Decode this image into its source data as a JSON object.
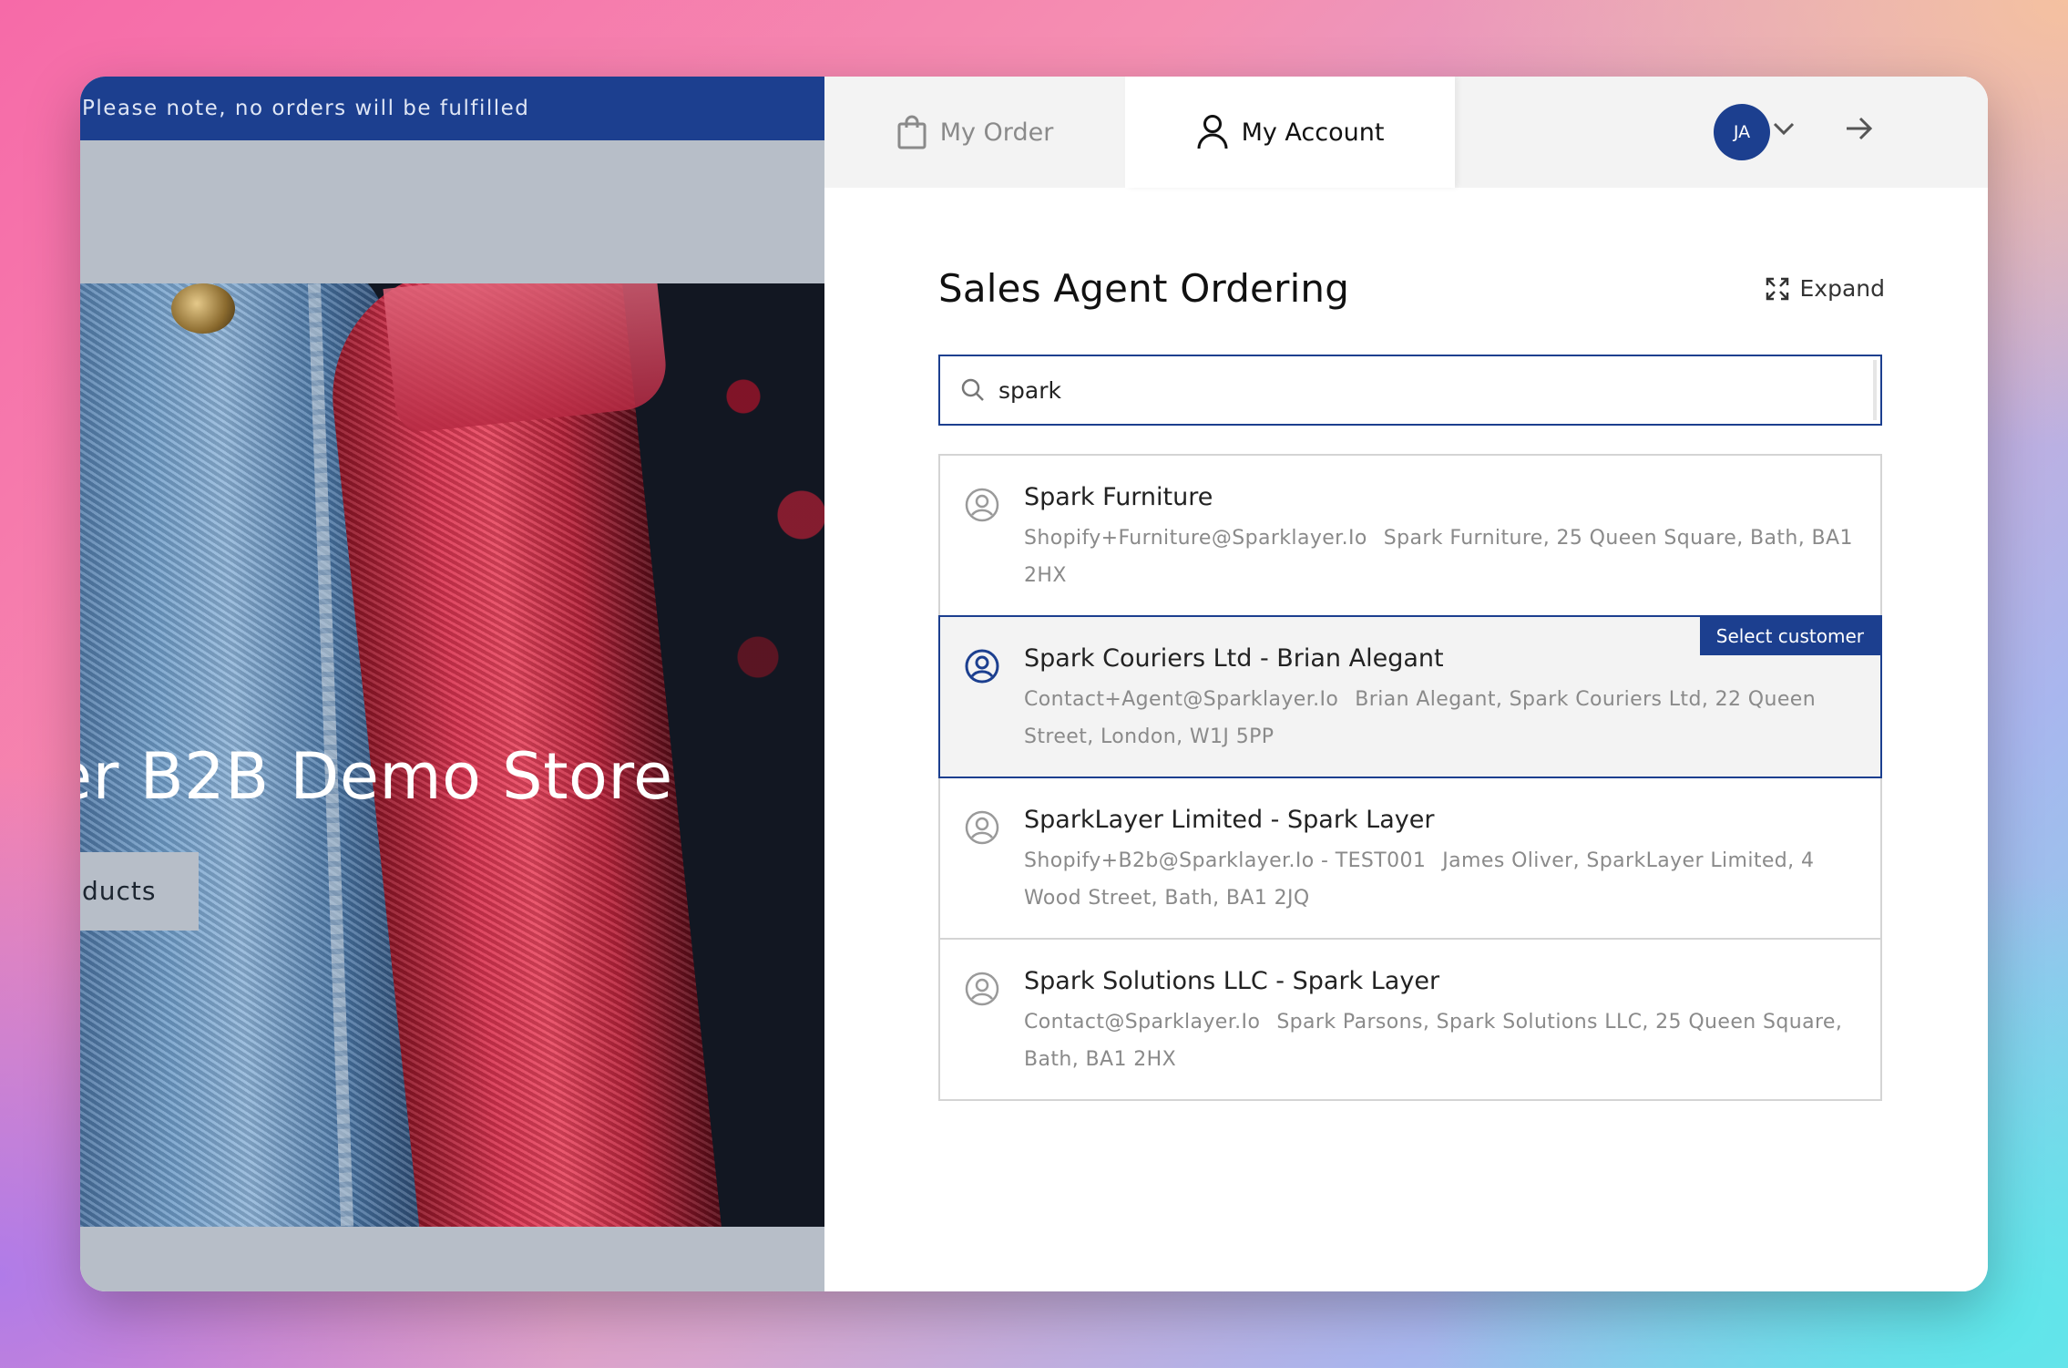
{
  "store": {
    "announcement": "Please note, no orders will be fulfilled",
    "hero_title": "er B2B Demo Store",
    "hero_button": "ducts"
  },
  "tabs": {
    "order_label": "My Order",
    "account_label": "My Account"
  },
  "user": {
    "initials": "JA"
  },
  "panel": {
    "title": "Sales Agent Ordering",
    "expand_label": "Expand"
  },
  "search": {
    "value": "spark",
    "placeholder": ""
  },
  "results": [
    {
      "name": "Spark Furniture",
      "email": "Shopify+Furniture@Sparklayer.Io",
      "address": "Spark Furniture, 25 Queen Square, Bath, BA1 2HX"
    },
    {
      "name": "Spark Couriers Ltd - Brian Alegant",
      "email": "Contact+Agent@Sparklayer.Io",
      "address": "Brian Alegant, Spark Couriers Ltd, 22 Queen Street, London, W1J 5PP"
    },
    {
      "name": "SparkLayer Limited - Spark Layer",
      "email": "Shopify+B2b@Sparklayer.Io - TEST001",
      "address": "James Oliver, SparkLayer Limited, 4 Wood Street, Bath, BA1 2JQ"
    },
    {
      "name": "Spark Solutions LLC - Spark Layer",
      "email": "Contact@Sparklayer.Io",
      "address": "Spark Parsons, Spark Solutions LLC, 25 Queen Square, Bath, BA1 2HX"
    }
  ],
  "select_badge": "Select customer",
  "colors": {
    "accent": "#1c3f8f",
    "muted_text": "#8a8a8a",
    "border": "#d4d4d4"
  },
  "icons": {
    "order_tab": "shopping-bag-icon",
    "account_tab": "user-icon",
    "menu": "chevron-down-icon",
    "close_panel": "arrow-right-icon",
    "expand": "expand-icon",
    "search": "search-icon",
    "customer": "user-circle-icon"
  }
}
